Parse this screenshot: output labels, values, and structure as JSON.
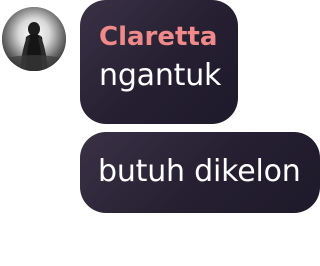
{
  "conversation": {
    "sender": {
      "name": "Claretta",
      "name_color": "#f08a8a"
    },
    "messages": [
      {
        "text": "ngantuk"
      },
      {
        "text": "butuh dikelon"
      }
    ],
    "colors": {
      "bubble_background": "#2a2336",
      "text": "#ffffff"
    }
  }
}
